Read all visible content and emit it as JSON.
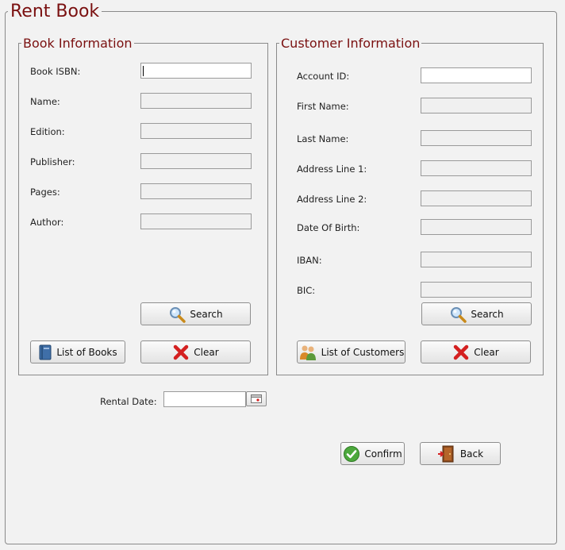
{
  "window": {
    "title": "Rent Book"
  },
  "book": {
    "title": "Book Information",
    "labels": {
      "isbn": "Book ISBN:",
      "name": "Name:",
      "edition": "Edition:",
      "publisher": "Publisher:",
      "pages": "Pages:",
      "author": "Author:"
    },
    "values": {
      "isbn": "",
      "name": "",
      "edition": "",
      "publisher": "",
      "pages": "",
      "author": ""
    },
    "search_label": "Search",
    "list_label": "List of Books",
    "clear_label": "Clear"
  },
  "customer": {
    "title": "Customer Information",
    "labels": {
      "account_id": "Account ID:",
      "first_name": "First Name:",
      "last_name": "Last Name:",
      "address1": "Address Line 1:",
      "address2": "Address Line 2:",
      "dob": "Date Of Birth:",
      "iban": "IBAN:",
      "bic": "BIC:"
    },
    "values": {
      "account_id": "",
      "first_name": "",
      "last_name": "",
      "address1": "",
      "address2": "",
      "dob": "",
      "iban": "",
      "bic": ""
    },
    "search_label": "Search",
    "list_label": "List of Customers",
    "clear_label": "Clear"
  },
  "rental": {
    "label": "Rental Date:",
    "value": ""
  },
  "actions": {
    "confirm_label": "Confirm",
    "back_label": "Back"
  },
  "icons": {
    "search": "magnifier-icon",
    "clear": "red-x-icon",
    "books": "book-icon",
    "customers": "people-icon",
    "calendar": "calendar-icon",
    "confirm": "green-check-icon",
    "back": "door-exit-icon"
  },
  "colors": {
    "title": "#7a1010",
    "border": "#8a8a8a",
    "background": "#f2f2f2"
  }
}
